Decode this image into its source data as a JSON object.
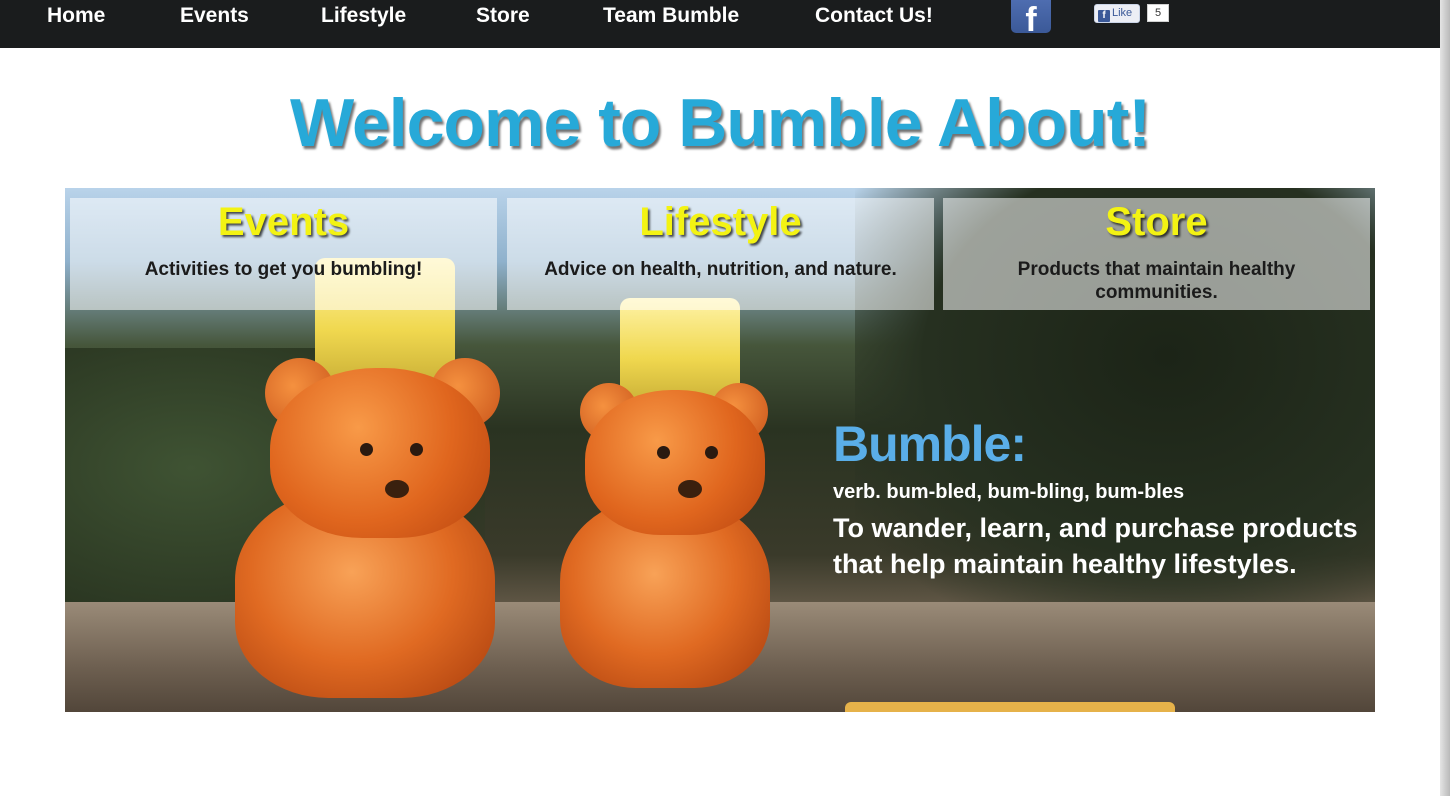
{
  "nav": {
    "items": [
      {
        "label": "Home"
      },
      {
        "label": "Events"
      },
      {
        "label": "Lifestyle"
      },
      {
        "label": "Store"
      },
      {
        "label": "Team Bumble"
      },
      {
        "label": "Contact Us!"
      }
    ],
    "facebook_icon": "facebook-icon",
    "like_label": "Like",
    "like_count": "5"
  },
  "page": {
    "title": "Welcome to Bumble About!"
  },
  "categories": [
    {
      "title": "Events",
      "description": "Activities to get you bumbling!"
    },
    {
      "title": "Lifestyle",
      "description": "Advice on health, nutrition, and nature."
    },
    {
      "title": "Store",
      "description": "Products that maintain healthy communities."
    }
  ],
  "definition": {
    "word": "Bumble:",
    "part_of_speech": "verb. bum-bled, bum-bling, bum-bles",
    "meaning": "To wander, learn, and purchase products that help maintain healthy lifestyles."
  },
  "colors": {
    "nav_bg": "#1a1c1d",
    "title": "#27a9d8",
    "category_title": "#f3f313",
    "definition_word": "#5aaee8"
  }
}
